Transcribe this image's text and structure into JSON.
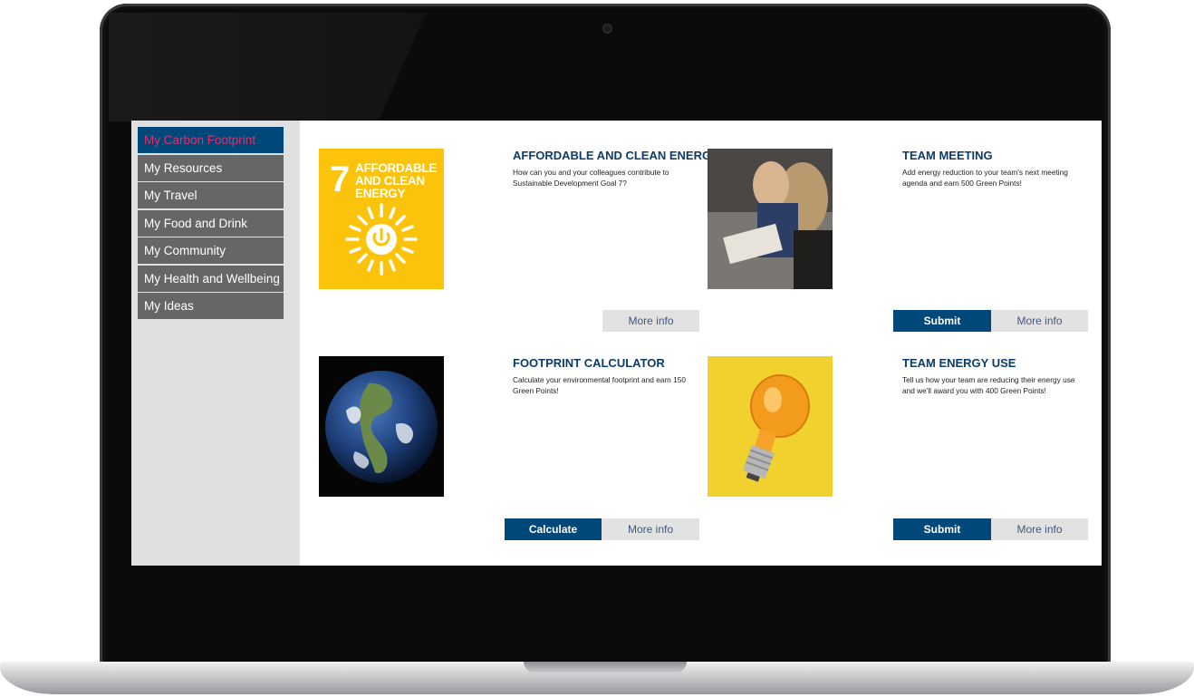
{
  "sidebar": {
    "items": [
      {
        "label": "My Carbon Footprint",
        "active": true
      },
      {
        "label": "My Resources",
        "active": false
      },
      {
        "label": "My Travel",
        "active": false
      },
      {
        "label": "My Food and Drink",
        "active": false
      },
      {
        "label": "My Community",
        "active": false
      },
      {
        "label": "My Health and Wellbeing",
        "active": false
      },
      {
        "label": "My Ideas",
        "active": false
      }
    ]
  },
  "cards": [
    {
      "title": "AFFORDABLE AND CLEAN ENERGY",
      "description": "How can you and your colleagues contribute to Sustainable Development Goal 7?",
      "image": "sdg-7-icon",
      "tile_number": "7",
      "tile_text": "AFFORDABLE AND CLEAN ENERGY",
      "buttons": {
        "more": "More info"
      }
    },
    {
      "title": "TEAM MEETING",
      "description": "Add energy reduction to your team's next meeting agenda and earn 500 Green Points!",
      "image": "team-meeting-photo",
      "buttons": {
        "primary": "Submit",
        "more": "More info"
      }
    },
    {
      "title": "FOOTPRINT CALCULATOR",
      "description": "Calculate your environmental footprint and earn 150 Green Points!",
      "image": "earth-photo",
      "buttons": {
        "primary": "Calculate",
        "more": "More info"
      }
    },
    {
      "title": "TEAM ENERGY USE",
      "description": "Tell us how your team are reducing their energy use and we'll award you with 400 Green Points!",
      "image": "light-bulb-photo",
      "buttons": {
        "primary": "Submit",
        "more": "More info"
      }
    }
  ],
  "colors": {
    "sidebar_bg": "#e0e0e0",
    "nav_item": "#666666",
    "nav_active": "#00477a",
    "nav_active_text": "#e0306a",
    "primary_button": "#00477a",
    "title": "#0b3c6a",
    "sdg_yellow": "#fcc30b"
  }
}
